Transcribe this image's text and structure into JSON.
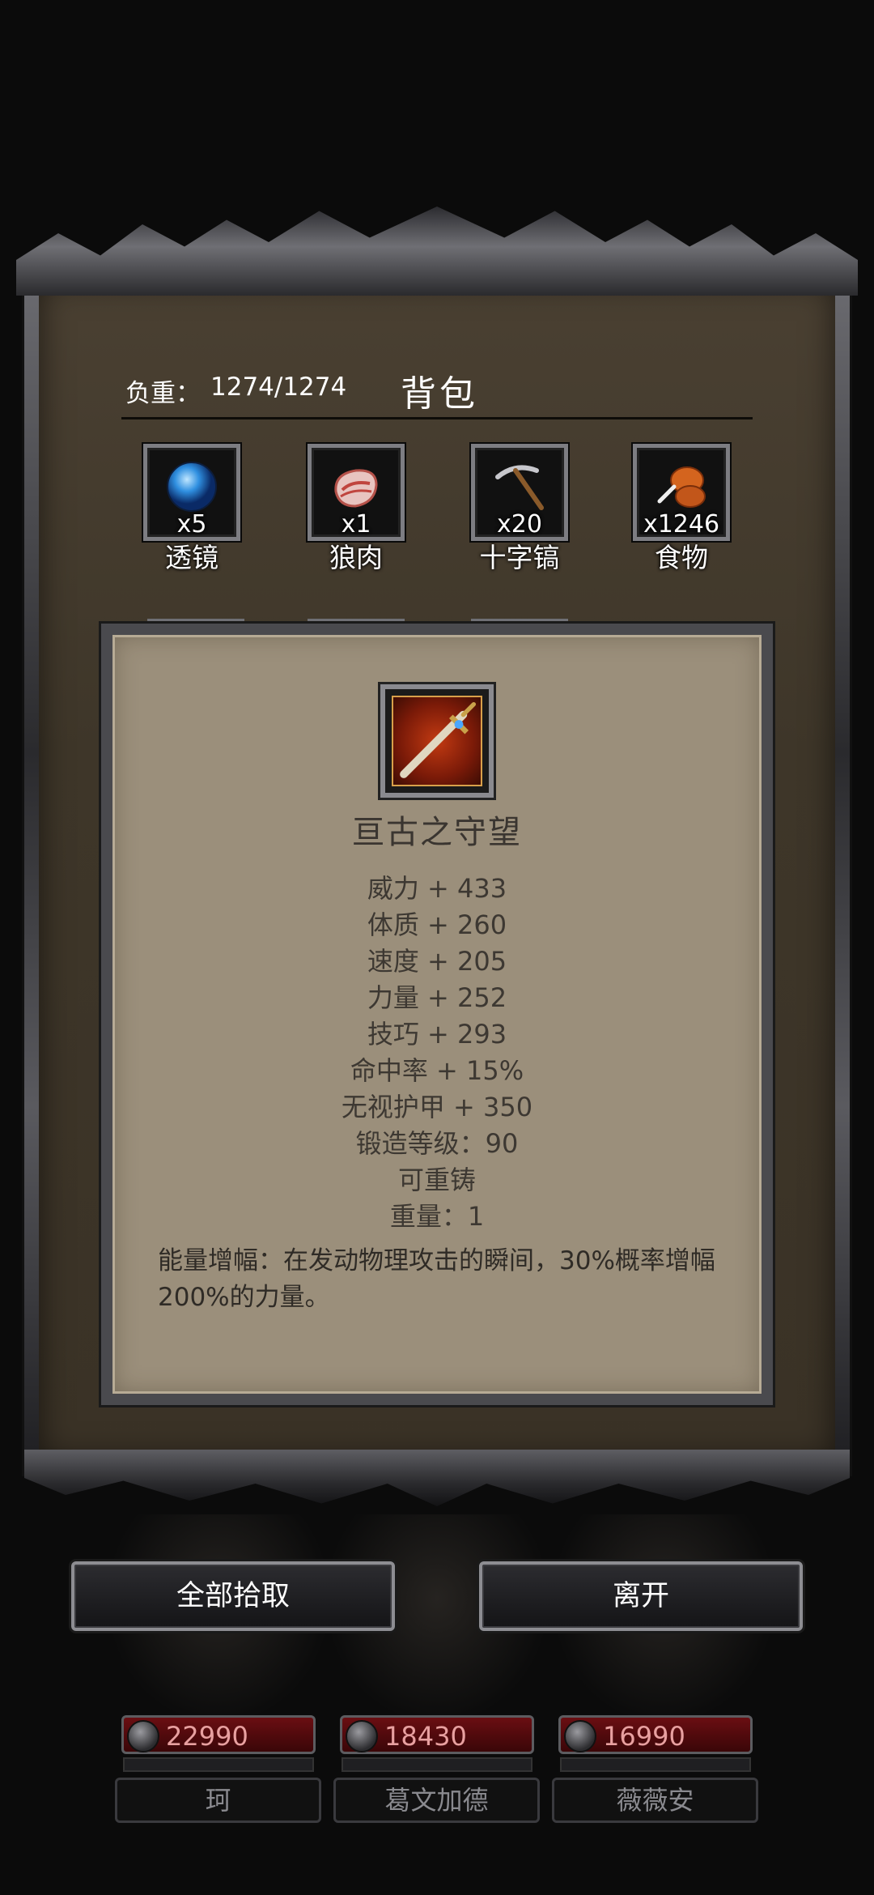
{
  "header": {
    "weight_label": "负重：",
    "weight_value": "1274/1274",
    "title": "背包"
  },
  "items": [
    {
      "name": "透镜",
      "count": "x5",
      "icon": "lens-orb-icon"
    },
    {
      "name": "狼肉",
      "count": "x1",
      "icon": "wolf-meat-icon"
    },
    {
      "name": "十字镐",
      "count": "x20",
      "icon": "pickaxe-icon"
    },
    {
      "name": "食物",
      "count": "x1246",
      "icon": "food-drumstick-icon"
    }
  ],
  "popup": {
    "item_name": "亘古之守望",
    "icon": "sword-icon",
    "stats": [
      "威力 + 433",
      "体质 + 260",
      "速度 + 205",
      "力量 + 252",
      "技巧 + 293",
      "命中率 + 15%",
      "无视护甲 + 350",
      "锻造等级：90",
      "可重铸",
      "重量：1"
    ],
    "description": "能量增幅：在发动物理攻击的瞬间，30%概率增幅200%的力量。"
  },
  "buttons": {
    "pickup_all": "全部拾取",
    "leave": "离开"
  },
  "party": [
    {
      "name": "珂",
      "hp": "22990"
    },
    {
      "name": "葛文加德",
      "hp": "18430"
    },
    {
      "name": "薇薇安",
      "hp": "16990"
    }
  ]
}
